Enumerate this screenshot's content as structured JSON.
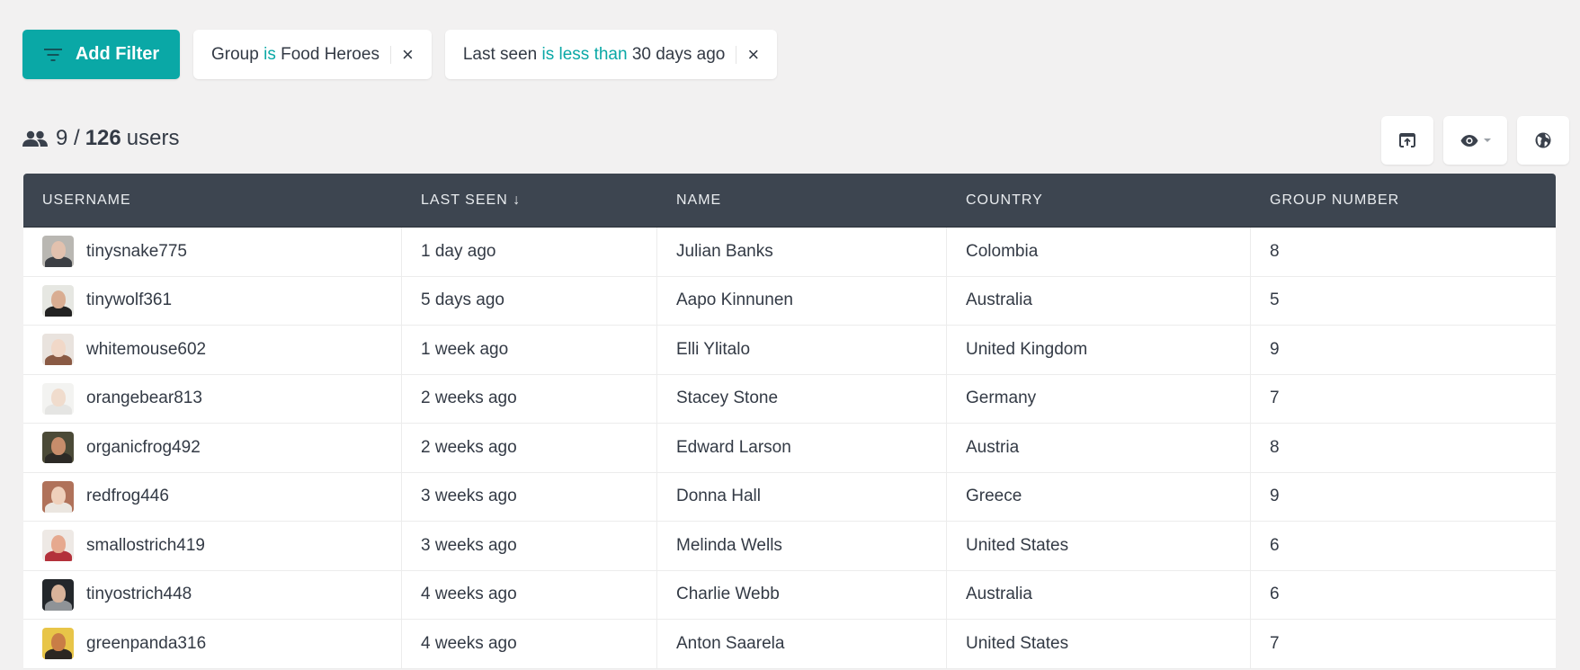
{
  "filters": {
    "add_filter_label": "Add Filter",
    "chips": [
      {
        "field": "Group",
        "operator": "is",
        "value": "Food Heroes"
      },
      {
        "field": "Last seen",
        "operator": "is less than",
        "value": "30 days ago"
      }
    ],
    "close_glyph": "×"
  },
  "summary": {
    "shown": "9",
    "separator": "/",
    "total": "126",
    "unit": "users"
  },
  "toolbar": {
    "buttons": [
      "export-icon",
      "eye-icon",
      "globe-icon"
    ]
  },
  "colors": {
    "accent": "#0aa8a6",
    "header_bg": "#3d4550",
    "page_bg": "#f2f1f1"
  },
  "table": {
    "columns": [
      "USERNAME",
      "LAST SEEN ↓",
      "NAME",
      "COUNTRY",
      "GROUP NUMBER"
    ],
    "rows": [
      {
        "username": "tinysnake775",
        "last_seen": "1 day ago",
        "name": "Julian Banks",
        "country": "Colombia",
        "group": "8",
        "avatar_bg": "#b9b7b2",
        "skin": "#e2c1ae",
        "shirt": "#3c3f44"
      },
      {
        "username": "tinywolf361",
        "last_seen": "5 days ago",
        "name": "Aapo Kinnunen",
        "country": "Australia",
        "group": "5",
        "avatar_bg": "#e6e7e2",
        "skin": "#d9ad92",
        "shirt": "#222"
      },
      {
        "username": "whitemouse602",
        "last_seen": "1 week ago",
        "name": "Elli Ylitalo",
        "country": "United Kingdom",
        "group": "9",
        "avatar_bg": "#e9e3de",
        "skin": "#f1d8c8",
        "shirt": "#8a5a44"
      },
      {
        "username": "orangebear813",
        "last_seen": "2 weeks ago",
        "name": "Stacey Stone",
        "country": "Germany",
        "group": "7",
        "avatar_bg": "#f3f3f1",
        "skin": "#f0dccd",
        "shirt": "#e5e5e3"
      },
      {
        "username": "organicfrog492",
        "last_seen": "2 weeks ago",
        "name": "Edward Larson",
        "country": "Austria",
        "group": "8",
        "avatar_bg": "#4b4a37",
        "skin": "#c78d6b",
        "shirt": "#2c2a26"
      },
      {
        "username": "redfrog446",
        "last_seen": "3 weeks ago",
        "name": "Donna Hall",
        "country": "Greece",
        "group": "9",
        "avatar_bg": "#b0725a",
        "skin": "#efd0bb",
        "shirt": "#ebe6e0"
      },
      {
        "username": "smallostrich419",
        "last_seen": "3 weeks ago",
        "name": "Melinda Wells",
        "country": "United States",
        "group": "6",
        "avatar_bg": "#eee9e5",
        "skin": "#e6a98f",
        "shirt": "#b3313b"
      },
      {
        "username": "tinyostrich448",
        "last_seen": "4 weeks ago",
        "name": "Charlie Webb",
        "country": "Australia",
        "group": "6",
        "avatar_bg": "#23272b",
        "skin": "#d8b39a",
        "shirt": "#8f9397"
      },
      {
        "username": "greenpanda316",
        "last_seen": "4 weeks ago",
        "name": "Anton Saarela",
        "country": "United States",
        "group": "7",
        "avatar_bg": "#e8c548",
        "skin": "#c97d46",
        "shirt": "#2c2722"
      }
    ]
  }
}
